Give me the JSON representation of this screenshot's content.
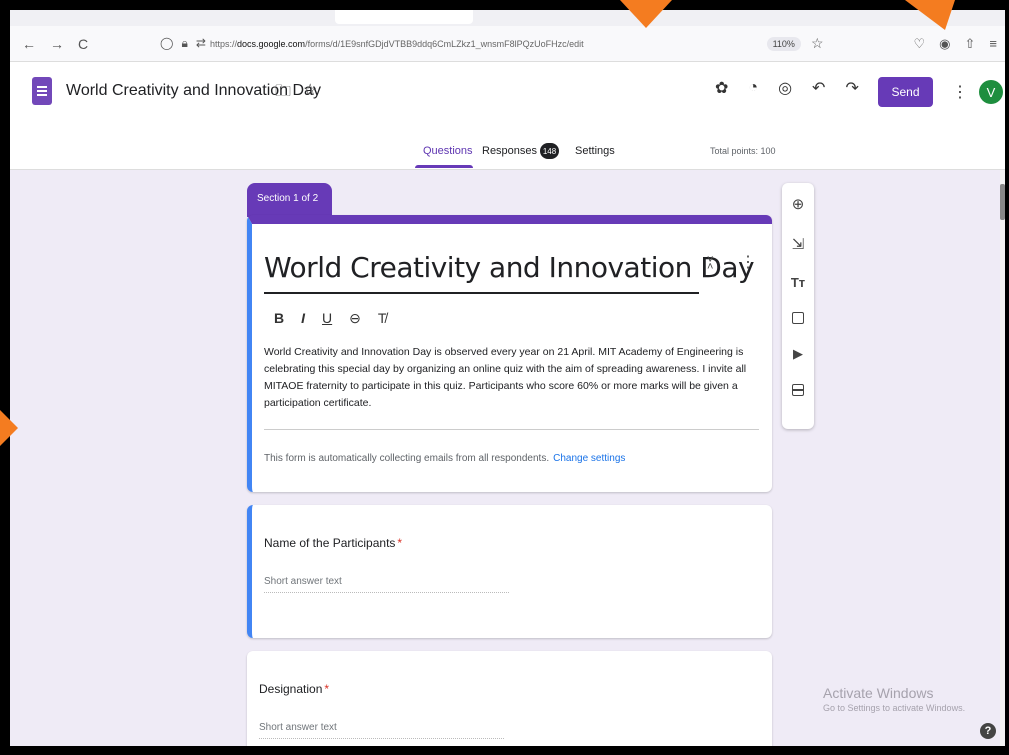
{
  "browser": {
    "nav_back": "←",
    "nav_forward": "→",
    "nav_reload": "C",
    "url_prefix": "https://",
    "url_domain": "docs.google.com",
    "url_path": "/forms/d/1E9snfGDjdVTBB9ddq6CmLZkz1_wnsmF8lPQzUoFHzc/edit",
    "zoom": "110%"
  },
  "header": {
    "form_title": "World Creativity and Innovation Day",
    "send_label": "Send",
    "avatar_initial": "V"
  },
  "tabs": {
    "questions": "Questions",
    "responses": "Responses",
    "responses_count": "148",
    "settings": "Settings",
    "total_points": "Total points: 100"
  },
  "section": {
    "label": "Section 1 of 2"
  },
  "form_header": {
    "title": "World Creativity and Innovation Day",
    "format_bold": "B",
    "format_italic": "I",
    "format_underline": "U",
    "format_link": "⊖",
    "format_clear": "T̸",
    "description": "World Creativity and Innovation Day is observed every year on 21 April. MIT Academy of Engineering is celebrating this special day by organizing an online quiz with the aim of spreading awareness. I invite all MITAOE fraternity to participate in this quiz. Participants who score 60% or more marks will be given a participation certificate.",
    "collect_notice": "This form is automatically collecting emails from all respondents.",
    "change_settings": "Change settings"
  },
  "questions": [
    {
      "label": "Name of the Participants",
      "required_mark": "*",
      "placeholder": "Short answer text"
    },
    {
      "label": "Designation",
      "required_mark": "*",
      "placeholder": "Short answer text"
    }
  ],
  "side_toolbar": {
    "text_icon_glyph": "Tт"
  },
  "watermark": {
    "line1": "Activate Windows",
    "line2": "Go to Settings to activate Windows."
  },
  "help_glyph": "?"
}
